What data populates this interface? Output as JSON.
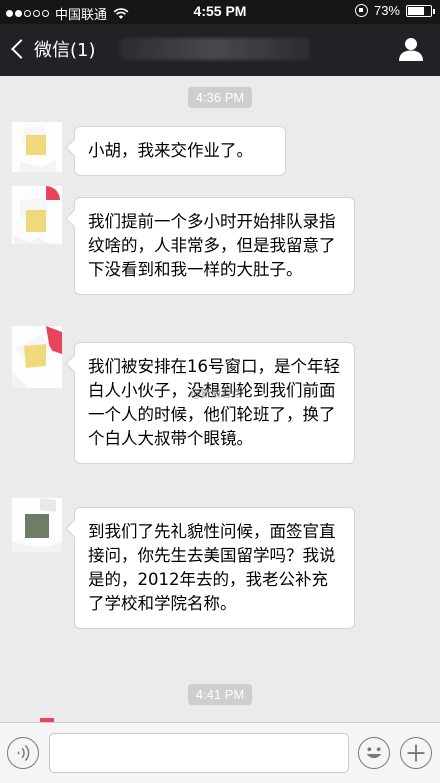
{
  "status_bar": {
    "carrier": "中国联通",
    "time": "4:55 PM",
    "battery": "73%",
    "battery_level": 0.73,
    "signal_bars_filled": 2,
    "signal_bars_total": 5
  },
  "nav": {
    "back_label": "微信(1)",
    "title_blurred": true
  },
  "chat": {
    "timestamps": [
      "4:36 PM",
      "4:41 PM"
    ],
    "messages": [
      {
        "text": "小胡，我来交作业了。"
      },
      {
        "text": "我们提前一个多小时开始排队录指纹啥的，人非常多，但是我留意了下没看到和我一样的大肚子。"
      },
      {
        "text": "我们被安排在16号窗口，是个年轻白人小伙子，没想到轮到我们前面一个人的时候，他们轮班了，换了个白人大叔带个眼镜。"
      },
      {
        "text": "到我们了先礼貌性问候，面签官直接问，你先生去美国留学吗？我说是的，2012年去的，我老公补充了学校和学院名称。"
      }
    ],
    "watermark": "@新浪看点"
  },
  "input_bar": {
    "message_value": ""
  },
  "colors": {
    "status_bar": "#161616",
    "nav_bar": "#202226",
    "chat_background": "#ebebeb",
    "bubble": "#ffffff",
    "timestamp_chip": "#cecece",
    "avatar_yellow": "#f0d97a",
    "avatar_red": "#e8455a",
    "avatar_green": "#6e7d66"
  },
  "icons": [
    "signal-dots-icon",
    "wifi-icon",
    "rotation-lock-icon",
    "battery-icon",
    "chevron-left-icon",
    "person-icon",
    "voice-icon",
    "emoji-icon",
    "plus-icon"
  ]
}
